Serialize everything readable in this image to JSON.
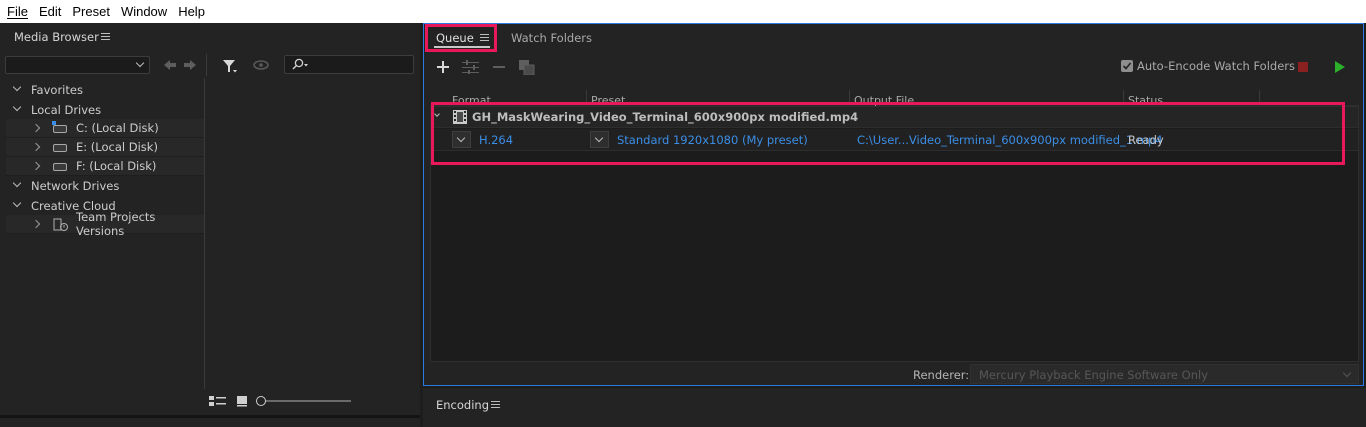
{
  "menu": [
    {
      "label": "File"
    },
    {
      "label": "Edit"
    },
    {
      "label": "Preset"
    },
    {
      "label": "Window"
    },
    {
      "label": "Help"
    }
  ],
  "media_browser": {
    "title": "Media Browser",
    "search_placeholder": "",
    "tree": {
      "favorites": "Favorites",
      "local_drives": "Local Drives",
      "drive_c": "C: (Local Disk)",
      "drive_e": "E: (Local Disk)",
      "drive_f": "F: (Local Disk)",
      "network_drives": "Network Drives",
      "creative_cloud": "Creative Cloud",
      "team_projects": "Team Projects Versions"
    }
  },
  "queue": {
    "tab_queue": "Queue",
    "tab_watch": "Watch Folders",
    "auto_encode_label": "Auto-Encode Watch Folders",
    "auto_encode_checked": true,
    "columns": {
      "format": "Format",
      "preset": "Preset",
      "output": "Output File",
      "status": "Status"
    },
    "item": {
      "name": "GH_MaskWearing_Video_Terminal_600x900px modified.mp4",
      "format": "H.264",
      "preset": "Standard 1920x1080 (My preset)",
      "output": "C:\\User...Video_Terminal_600x900px modified_1.mp4",
      "status": "Ready"
    },
    "renderer_label": "Renderer:",
    "renderer_value": "Mercury Playback Engine Software Only"
  },
  "encoding": {
    "title": "Encoding"
  },
  "colors": {
    "accent": "#2a7ae2",
    "highlight": "#e8185a",
    "link": "#3b8ee6",
    "play": "#2bb02b",
    "stop": "#a02525"
  }
}
